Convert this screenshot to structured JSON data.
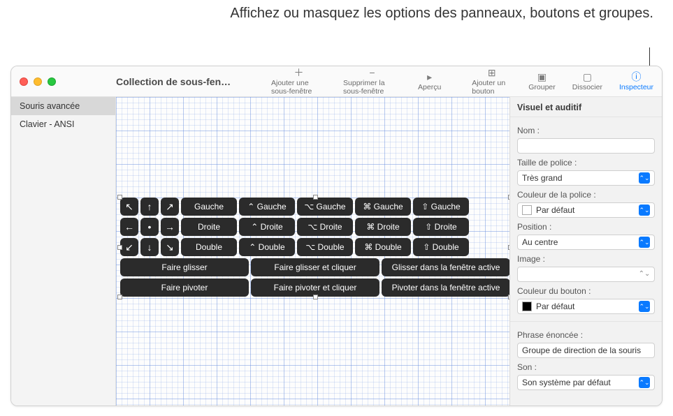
{
  "callout": "Affichez ou masquez les options des panneaux, boutons et groupes.",
  "window_title": "Collection de sous-fen…",
  "toolbar": {
    "add_panel": "Ajouter une sous-fenêtre",
    "delete_panel": "Supprimer la sous-fenêtre",
    "preview": "Aperçu",
    "add_button": "Ajouter un bouton",
    "group": "Grouper",
    "ungroup": "Dissocier",
    "inspector": "Inspecteur"
  },
  "sidebar": {
    "items": [
      {
        "label": "Souris avancée",
        "selected": true
      },
      {
        "label": "Clavier - ANSI",
        "selected": false
      }
    ]
  },
  "panel_buttons": {
    "row1_arrows": [
      "↖",
      "↑",
      "↗"
    ],
    "row2_arrows": [
      "←",
      "•",
      "→"
    ],
    "row3_arrows": [
      "↙",
      "↓",
      "↘"
    ],
    "dir_labels": [
      "Gauche",
      "Droite",
      "Double"
    ],
    "mods": {
      "ctrl": [
        "⌃ Gauche",
        "⌃ Droite",
        "⌃ Double"
      ],
      "opt": [
        "⌥ Gauche",
        "⌥ Droite",
        "⌥ Double"
      ],
      "cmd": [
        "⌘ Gauche",
        "⌘ Droite",
        "⌘ Double"
      ],
      "shift": [
        "⇧ Gauche",
        "⇧ Droite",
        "⇧ Double"
      ]
    },
    "row4": [
      "Faire glisser",
      "Faire glisser et cliquer",
      "Glisser dans la fenêtre active"
    ],
    "row5": [
      "Faire pivoter",
      "Faire pivoter et cliquer",
      "Pivoter dans la fenêtre active"
    ]
  },
  "inspector": {
    "header": "Visuel et auditif",
    "name_label": "Nom :",
    "name_value": "",
    "font_size_label": "Taille de police :",
    "font_size_value": "Très grand",
    "font_color_label": "Couleur de la police :",
    "font_color_value": "Par défaut",
    "position_label": "Position :",
    "position_value": "Au centre",
    "image_label": "Image :",
    "image_value": "",
    "button_color_label": "Couleur du bouton :",
    "button_color_value": "Par défaut",
    "phrase_label": "Phrase énoncée :",
    "phrase_value": "Groupe de direction de la souris",
    "sound_label": "Son :",
    "sound_value": "Son système par défaut"
  }
}
